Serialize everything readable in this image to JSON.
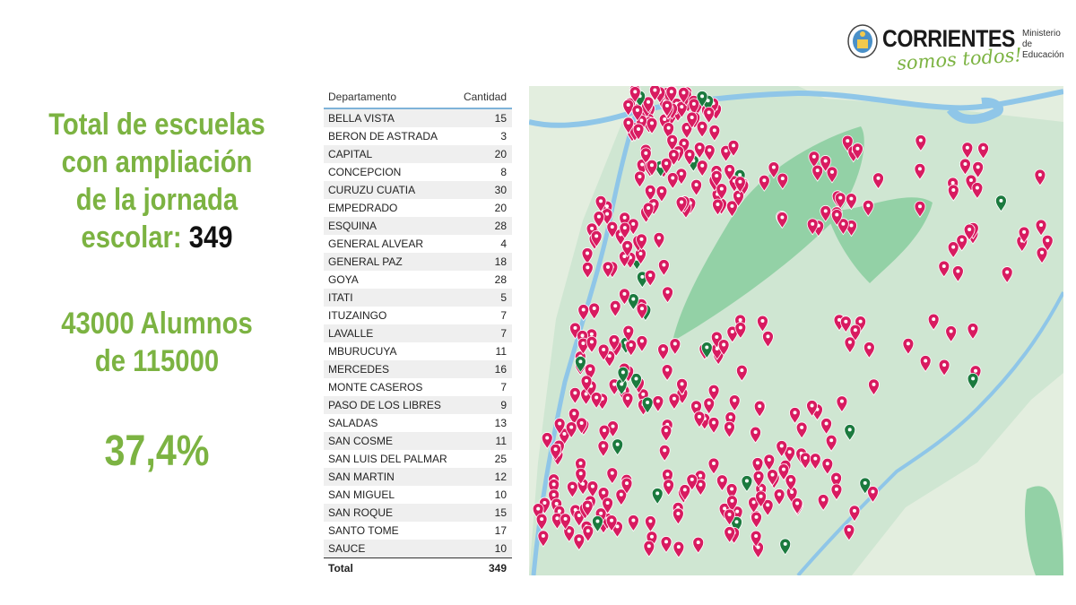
{
  "header": {
    "brand": "CORRIENTES",
    "tagline": "somos todos!",
    "ministry_line1": "Ministerio de",
    "ministry_line2": "Educación"
  },
  "stats": {
    "title_line1": "Total de escuelas",
    "title_line2": "con ampliación",
    "title_line3": "de la jornada",
    "title_line4_prefix": "escolar: ",
    "total_schools": "349",
    "students_line1": "43000 Alumnos",
    "students_line2": "de 115000",
    "percentage": "37,4%"
  },
  "table": {
    "header_department": "Departamento",
    "header_count": "Cantidad",
    "rows": [
      {
        "name": "BELLA VISTA",
        "count": "15"
      },
      {
        "name": "BERON DE ASTRADA",
        "count": "3"
      },
      {
        "name": "CAPITAL",
        "count": "20"
      },
      {
        "name": "CONCEPCION",
        "count": "8"
      },
      {
        "name": "CURUZU CUATIA",
        "count": "30"
      },
      {
        "name": "EMPEDRADO",
        "count": "20"
      },
      {
        "name": "ESQUINA",
        "count": "28"
      },
      {
        "name": "GENERAL ALVEAR",
        "count": "4"
      },
      {
        "name": "GENERAL PAZ",
        "count": "18"
      },
      {
        "name": "GOYA",
        "count": "28"
      },
      {
        "name": "ITATI",
        "count": "5"
      },
      {
        "name": "ITUZAINGO",
        "count": "7"
      },
      {
        "name": "LAVALLE",
        "count": "7"
      },
      {
        "name": "MBURUCUYA",
        "count": "11"
      },
      {
        "name": "MERCEDES",
        "count": "16"
      },
      {
        "name": "MONTE CASEROS",
        "count": "7"
      },
      {
        "name": "PASO DE LOS LIBRES",
        "count": "9"
      },
      {
        "name": "SALADAS",
        "count": "13"
      },
      {
        "name": "SAN COSME",
        "count": "11"
      },
      {
        "name": "SAN LUIS DEL PALMAR",
        "count": "25"
      },
      {
        "name": "SAN MARTIN",
        "count": "12"
      },
      {
        "name": "SAN MIGUEL",
        "count": "10"
      },
      {
        "name": "SAN ROQUE",
        "count": "15"
      },
      {
        "name": "SANTO TOME",
        "count": "17"
      },
      {
        "name": "SAUCE",
        "count": "10"
      }
    ],
    "total_label": "Total",
    "total_value": "349"
  },
  "map": {
    "land_color": "#cfe6d2",
    "wetland_color": "#93d1a6",
    "river_color": "#8fc6e8",
    "pink_marker_color": "#d81b60",
    "green_marker_color": "#1b7a3e"
  }
}
